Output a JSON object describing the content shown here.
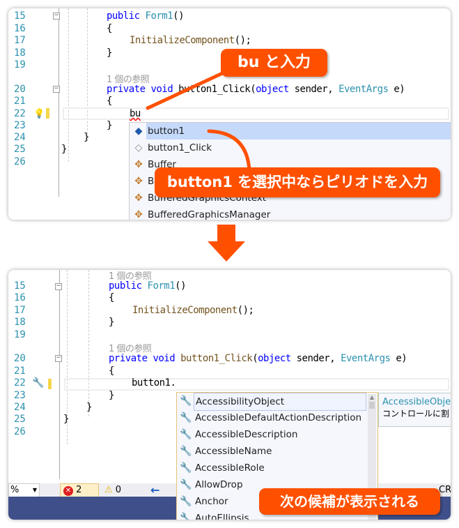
{
  "top": {
    "line_numbers": [
      "15",
      "16",
      "17",
      "18",
      "19",
      "20",
      "21",
      "22",
      "23",
      "24",
      "25",
      "26"
    ],
    "ref_text": "1 個の参照",
    "code": {
      "public": "public",
      "form1": "Form1",
      "paren": "()",
      "lbrace": "{",
      "rbrace": "}",
      "init": "InitializeComponent",
      "init_tail": "();",
      "private": "private",
      "void": "void",
      "method": "button1_Click",
      "open": "(",
      "object": "object",
      "sender": " sender, ",
      "eventargs": "EventArgs",
      "tail": " e)",
      "typed": "bu"
    },
    "completion": [
      {
        "label": "button1",
        "icon": "field-lock-icon",
        "selected": true
      },
      {
        "label": "button1_Click",
        "icon": "method-lock-icon"
      },
      {
        "label": "Buffer",
        "icon": "class-icon"
      },
      {
        "label": "B",
        "icon": "class-icon"
      },
      {
        "label": "BufferedGraphicsContext",
        "icon": "class-icon"
      },
      {
        "label": "BufferedGraphicsManager",
        "icon": "class-icon"
      }
    ],
    "callout1": "bu と入力",
    "callout2": "button1 を選択中ならピリオドを入力"
  },
  "bottom": {
    "line_numbers": [
      "15",
      "16",
      "17",
      "18",
      "19",
      "20",
      "21",
      "22",
      "23",
      "24",
      "25",
      "26"
    ],
    "ref_text": "1 個の参照",
    "typed": "button1.",
    "completion": [
      {
        "label": "AccessibilityObject",
        "icon": "wrench-icon",
        "selected": true
      },
      {
        "label": "AccessibleDefaultActionDescription",
        "icon": "wrench-icon"
      },
      {
        "label": "AccessibleDescription",
        "icon": "wrench-icon"
      },
      {
        "label": "AccessibleName",
        "icon": "wrench-icon"
      },
      {
        "label": "AccessibleRole",
        "icon": "wrench-icon"
      },
      {
        "label": "AllowDrop",
        "icon": "wrench-icon"
      },
      {
        "label": "Anchor",
        "icon": "wrench-icon"
      },
      {
        "label": "AutoEllipsis",
        "icon": "wrench-icon"
      }
    ],
    "tooltip": {
      "title": "AccessibleObje",
      "desc": "コントロールに割り"
    },
    "status": {
      "zoom": "%",
      "errors": "2",
      "warnings": "0",
      "crlf": "CRL"
    },
    "callout3": "次の候補が表示される"
  },
  "colors": {
    "accent": "#ff5000",
    "keyword": "#0000ff",
    "type": "#2b91af",
    "selection": "#c5d9fb"
  }
}
